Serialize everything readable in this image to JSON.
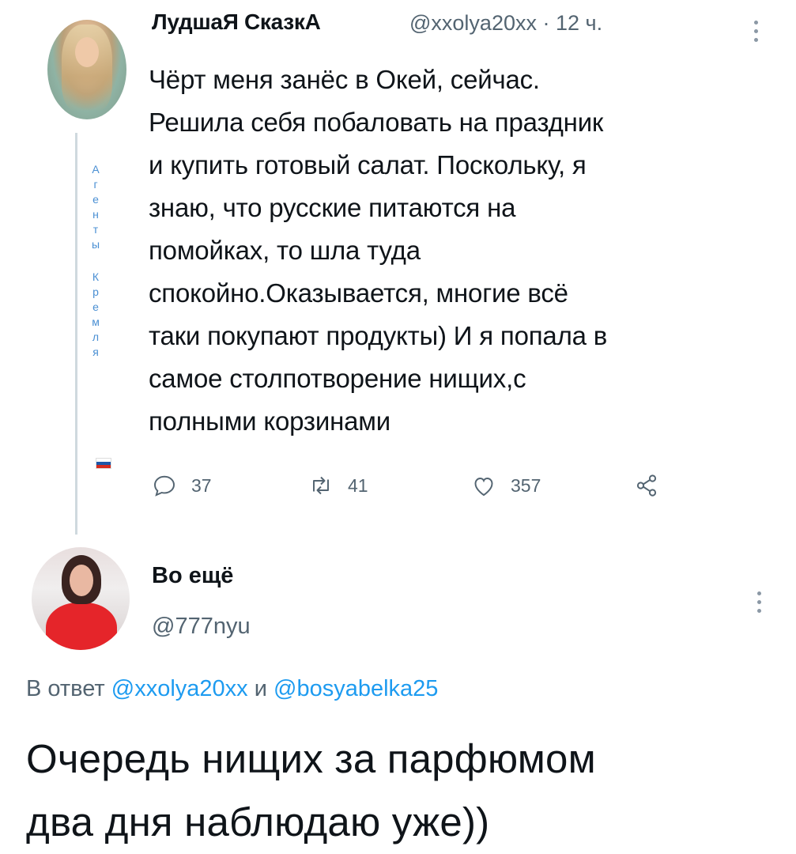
{
  "tweet1": {
    "author_name": "ЛудшаЯ СказкА",
    "handle": "@xxolya20xx",
    "separator": "·",
    "time": "12 ч.",
    "text": "Чёрт меня занёс в Окей, сейчас.\nРешила себя побаловать на праздник\nи купить готовый салат. Поскольку, я\nзнаю, что русские питаются  на\nпомойках, то шла туда\nспокойно.Оказывается, многие  всё\nтаки покупают продукты) И я попала в\nсамое столпотворение нищих,с\nполными корзинами",
    "vertical_label_1": [
      "А",
      "г",
      "е",
      "н",
      "т",
      "ы"
    ],
    "vertical_label_2": [
      "К",
      "р",
      "е",
      "м",
      "л",
      "я"
    ],
    "flag_colors": [
      "#ffffff",
      "#1c57a8",
      "#d52b1e"
    ],
    "actions": {
      "replies": "37",
      "retweets": "41",
      "likes": "357"
    },
    "icons": [
      "reply-icon",
      "retweet-icon",
      "like-icon",
      "share-icon",
      "more-icon"
    ]
  },
  "tweet2": {
    "author_name": "Во ещё",
    "handle": "@777nyu",
    "reply_prefix": "В ответ",
    "reply_user_1": "@xxolya20xx",
    "reply_and": "и",
    "reply_user_2": "@bosyabelka25",
    "text": "Очередь нищих за парфюмом\nдва дня наблюдаю уже))"
  },
  "colors": {
    "link": "#1d9bf0",
    "secondary_text": "#536471",
    "thread_line": "#cfd9de",
    "vertical_label": "#4a8fd3"
  }
}
